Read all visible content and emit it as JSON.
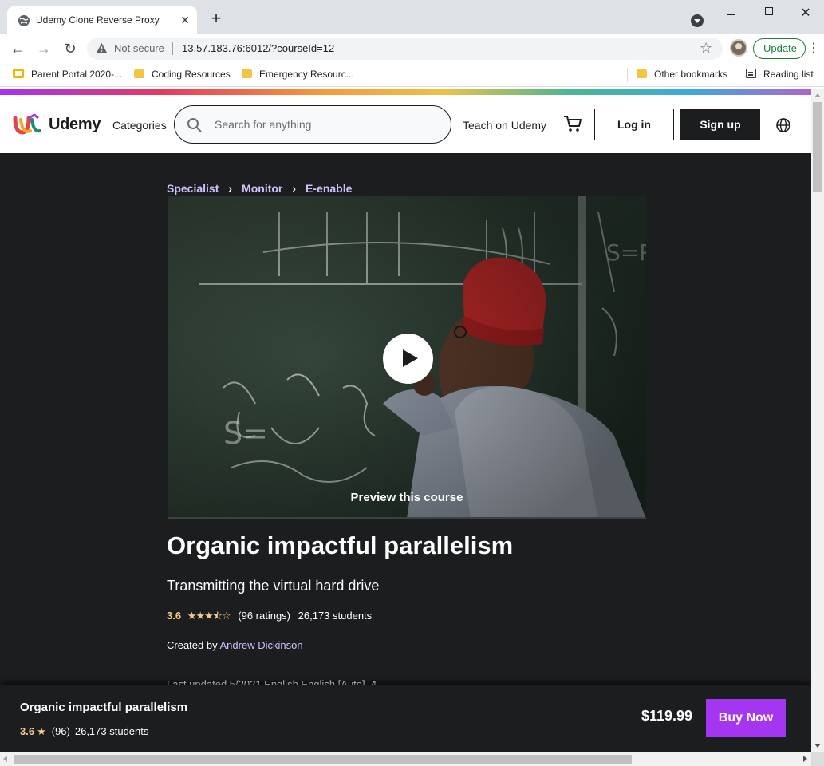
{
  "browser": {
    "tab_title": "Udemy Clone Reverse Proxy",
    "tab_close": "✕",
    "new_tab": "+",
    "not_secure": "Not secure",
    "url": "13.57.183.76:6012/?courseId=12",
    "update_label": "Update",
    "bookmarks": [
      {
        "label": "Parent Portal 2020-...",
        "icon": "parent-portal-icon"
      },
      {
        "label": "Coding Resources",
        "icon": "folder-icon"
      },
      {
        "label": "Emergency Resourc...",
        "icon": "folder-icon"
      }
    ],
    "other_bookmarks": "Other bookmarks",
    "reading_list": "Reading list"
  },
  "site": {
    "logo_text": "Udemy",
    "categories": "Categories",
    "search_placeholder": "Search for anything",
    "teach": "Teach on Udemy",
    "login": "Log in",
    "signup": "Sign up"
  },
  "course": {
    "breadcrumbs": [
      "Specialist",
      "Monitor",
      "E-enable"
    ],
    "breadcrumb_sep": "›",
    "preview_label": "Preview this course",
    "title": "Organic impactful parallelism",
    "subtitle": "Transmitting the virtual hard drive",
    "rating": "3.6",
    "rating_value": 3.6,
    "stars": "★★★⯪☆",
    "ratings_count": "(96 ratings)",
    "students": "26,173 students",
    "created_by_prefix": "Created by ",
    "instructor": "Andrew Dickinson",
    "meta_partial": "Last updated 5/2021    English    English [Auto], 4"
  },
  "sticky": {
    "title": "Organic impactful parallelism",
    "rating": "3.6",
    "star": "★",
    "ratings_count": "(96)",
    "students": "26,173 students",
    "price": "$119.99",
    "buy_label": "Buy Now"
  },
  "colors": {
    "header_bg": "#ffffff",
    "page_bg": "#1c1d1f",
    "breadcrumb": "#cec0fc",
    "rating": "#f3ca8c",
    "buy_button": "#a435f0",
    "update_green": "#188038"
  }
}
